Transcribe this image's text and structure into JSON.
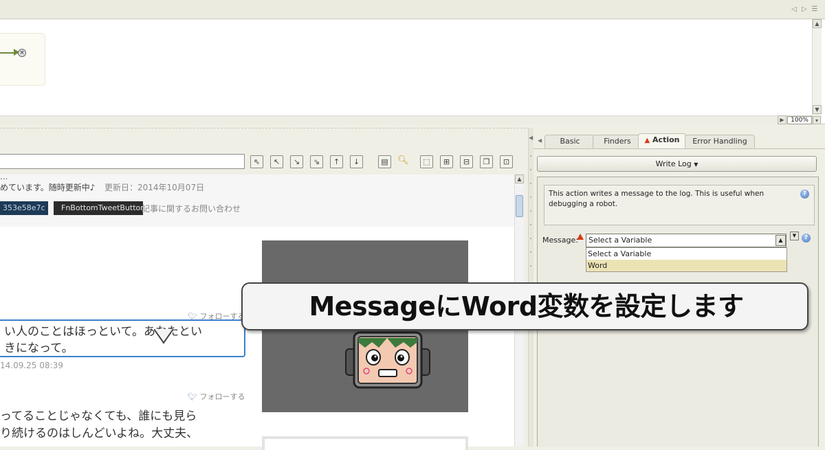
{
  "toolbar_top": {
    "icons": [
      "chevron-left-icon",
      "chevron-right-icon",
      "menu-icon"
    ]
  },
  "canvas": {
    "zoom": "100%"
  },
  "browser": {
    "url": "",
    "header_cut_text": "...",
    "header_line": "めています。随時更新中♪",
    "header_date": "更新日：2014年10月07日",
    "badge1": "353e58e7c",
    "badge2": "FnBottomTweetButton",
    "inquiry": "記事に関するお問い合わせ",
    "follow_label": "フォローする",
    "tweet1_line1": "い人のことはほっといて。あなたとい",
    "tweet1_line2": "きになって。",
    "tweet1_time": "14.09.25 08:39",
    "tweet2": "ってることじゃなくても、誰にも見ら\nり続けるのはしんどいよね。大丈夫、"
  },
  "panel": {
    "tabs": [
      "Basic",
      "Finders",
      "Action",
      "Error Handling"
    ],
    "active_tab": "Action",
    "action_dropdown": "Write Log",
    "description": "This action writes a message to the log. This is useful when debugging a robot.",
    "message_label": "Message:",
    "message_value": "Select a Variable",
    "options": [
      "Select a Variable",
      "Word"
    ],
    "highlighted_option": "Word"
  },
  "caption": "MessageにWord変数を設定します",
  "colors": {
    "accent_blue": "#3b7fd0",
    "warning": "#d23b1a",
    "highlight": "#ece3b5",
    "flow_green": "#6e8a3c"
  }
}
